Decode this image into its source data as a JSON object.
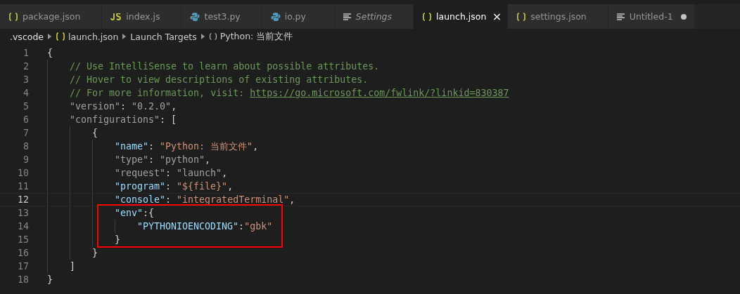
{
  "tabs": [
    {
      "label": "package.json",
      "kind": "braces",
      "selected": false,
      "italic": false,
      "dirty": false
    },
    {
      "label": "index.js",
      "kind": "js",
      "selected": false,
      "italic": false,
      "dirty": false
    },
    {
      "label": "test3.py",
      "kind": "python",
      "selected": false,
      "italic": false,
      "dirty": false
    },
    {
      "label": "io.py",
      "kind": "python",
      "selected": false,
      "italic": false,
      "dirty": false
    },
    {
      "label": "Settings",
      "kind": "lines",
      "selected": false,
      "italic": true,
      "dirty": false
    },
    {
      "label": "launch.json",
      "kind": "braces",
      "selected": true,
      "italic": false,
      "dirty": false,
      "close": "×"
    },
    {
      "label": "settings.json",
      "kind": "braces",
      "selected": false,
      "italic": false,
      "dirty": false
    },
    {
      "label": "Untitled-1",
      "kind": "lines",
      "selected": false,
      "italic": false,
      "dirty": true
    }
  ],
  "breadcrumb": [
    {
      "label": ".vscode",
      "kind": "folder"
    },
    {
      "label": "launch.json",
      "kind": "file"
    },
    {
      "label": "Launch Targets",
      "kind": "section"
    },
    {
      "label": "Python: 当前文件",
      "kind": "symbol"
    }
  ],
  "lines": [
    {
      "number": "1",
      "current": false,
      "boxed": false,
      "tokens": [
        {
          "kind": "punct",
          "text": "{"
        }
      ]
    },
    {
      "number": "2",
      "current": false,
      "boxed": false,
      "tokens": [
        {
          "kind": "comment",
          "text": "    // Use IntelliSense to learn about possible attributes."
        }
      ]
    },
    {
      "number": "3",
      "current": false,
      "boxed": false,
      "tokens": [
        {
          "kind": "comment",
          "text": "    // Hover to view descriptions of existing attributes."
        }
      ]
    },
    {
      "number": "4",
      "current": false,
      "boxed": false,
      "tokens": [
        {
          "kind": "comment",
          "text": "    // For more information, visit: "
        },
        {
          "kind": "link",
          "text": "https://go.microsoft.com/fwlink/?linkid=830387"
        }
      ]
    },
    {
      "number": "5",
      "current": false,
      "boxed": false,
      "tokens": [
        {
          "kind": "key-dim",
          "text": "    \"version\""
        },
        {
          "kind": "punct",
          "text": ": "
        },
        {
          "kind": "string-dim",
          "text": "\"0.2.0\""
        },
        {
          "kind": "punct",
          "text": ","
        }
      ]
    },
    {
      "number": "6",
      "current": false,
      "boxed": false,
      "tokens": [
        {
          "kind": "key-dim",
          "text": "    \"configurations\""
        },
        {
          "kind": "punct",
          "text": ": ["
        }
      ]
    },
    {
      "number": "7",
      "current": false,
      "boxed": false,
      "tokens": [
        {
          "kind": "punct",
          "text": "        {"
        }
      ]
    },
    {
      "number": "8",
      "current": false,
      "boxed": false,
      "tokens": [
        {
          "kind": "key",
          "text": "            \"name\""
        },
        {
          "kind": "punct",
          "text": ": "
        },
        {
          "kind": "string",
          "text": "\"Python: 当前文件\""
        },
        {
          "kind": "punct",
          "text": ","
        }
      ]
    },
    {
      "number": "9",
      "current": false,
      "boxed": false,
      "tokens": [
        {
          "kind": "key-dim",
          "text": "            \"type\""
        },
        {
          "kind": "punct",
          "text": ": "
        },
        {
          "kind": "string-dim",
          "text": "\"python\""
        },
        {
          "kind": "punct",
          "text": ","
        }
      ]
    },
    {
      "number": "10",
      "current": false,
      "boxed": false,
      "tokens": [
        {
          "kind": "key-dim",
          "text": "            \"request\""
        },
        {
          "kind": "punct",
          "text": ": "
        },
        {
          "kind": "string-dim",
          "text": "\"launch\""
        },
        {
          "kind": "punct",
          "text": ","
        }
      ]
    },
    {
      "number": "11",
      "current": false,
      "boxed": false,
      "tokens": [
        {
          "kind": "key",
          "text": "            \"program\""
        },
        {
          "kind": "punct",
          "text": ": "
        },
        {
          "kind": "string",
          "text": "\"${file}\""
        },
        {
          "kind": "punct",
          "text": ","
        }
      ]
    },
    {
      "number": "12",
      "current": true,
      "boxed": false,
      "tokens": [
        {
          "kind": "key",
          "text": "            \"console\""
        },
        {
          "kind": "punct",
          "text": ": "
        },
        {
          "kind": "string",
          "text": "\"integratedTerminal\""
        },
        {
          "kind": "punct",
          "text": ","
        }
      ]
    },
    {
      "number": "13",
      "current": false,
      "boxed": true,
      "tokens": [
        {
          "kind": "key",
          "text": "            \"env\""
        },
        {
          "kind": "punct",
          "text": ":{"
        }
      ]
    },
    {
      "number": "14",
      "current": false,
      "boxed": true,
      "tokens": [
        {
          "kind": "key",
          "text": "                \"PYTHONIOENCODING\""
        },
        {
          "kind": "punct",
          "text": ":"
        },
        {
          "kind": "string",
          "text": "\"gbk\""
        }
      ]
    },
    {
      "number": "15",
      "current": false,
      "boxed": true,
      "tokens": [
        {
          "kind": "punct",
          "text": "            }"
        }
      ]
    },
    {
      "number": "16",
      "current": false,
      "boxed": false,
      "tokens": [
        {
          "kind": "punct",
          "text": "        }"
        }
      ]
    },
    {
      "number": "17",
      "current": false,
      "boxed": false,
      "tokens": [
        {
          "kind": "punct",
          "text": "    ]"
        }
      ]
    },
    {
      "number": "18",
      "current": false,
      "boxed": false,
      "tokens": [
        {
          "kind": "punct",
          "text": "}"
        }
      ]
    }
  ]
}
